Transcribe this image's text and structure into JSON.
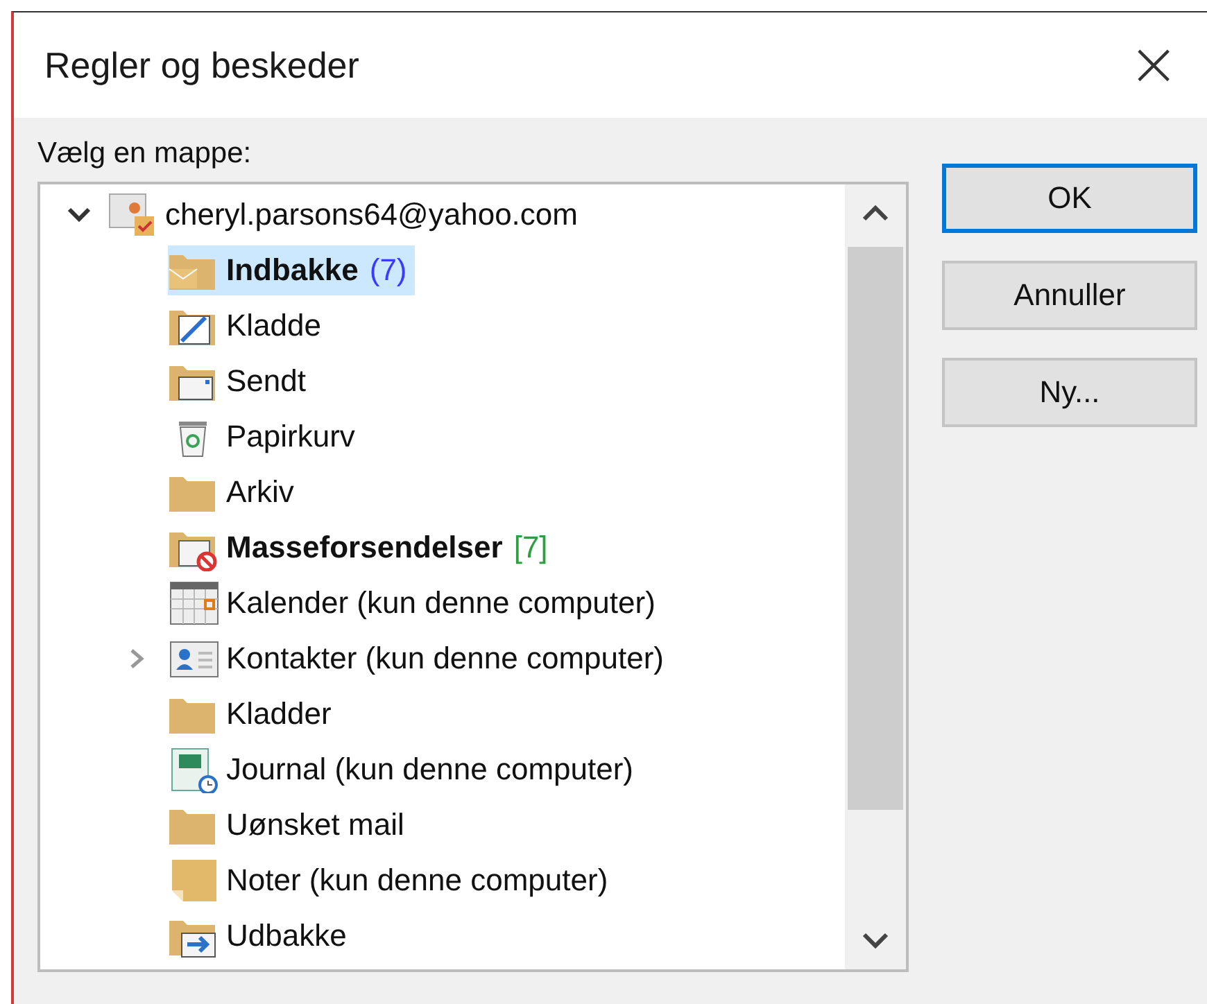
{
  "window": {
    "title": "Regler og beskeder",
    "close": "×"
  },
  "prompt": "Vælg en mappe:",
  "tree": {
    "root": {
      "label": "cheryl.parsons64@yahoo.com",
      "kind": "account",
      "expanded": true,
      "children": [
        {
          "label": "Indbakke",
          "kind": "inbox",
          "bold": true,
          "selected": true,
          "count": "(7)",
          "color": "#3b3bff"
        },
        {
          "label": "Kladde",
          "kind": "drafts",
          "bold": false,
          "selected": false
        },
        {
          "label": "Sendt",
          "kind": "sent",
          "bold": false,
          "selected": false
        },
        {
          "label": "Papirkurv",
          "kind": "trash",
          "bold": false,
          "selected": false
        },
        {
          "label": "Arkiv",
          "kind": "folder",
          "bold": false,
          "selected": false
        },
        {
          "label": "Masseforsendelser",
          "kind": "junk",
          "bold": true,
          "selected": false,
          "count": "[7]",
          "color": "#2e9e3e"
        },
        {
          "label": "Kalender (kun denne computer)",
          "kind": "calendar",
          "bold": false,
          "selected": false
        },
        {
          "label": "Kontakter (kun denne computer)",
          "kind": "contacts",
          "bold": false,
          "selected": false,
          "expanded": false
        },
        {
          "label": "Kladder",
          "kind": "folder",
          "bold": false,
          "selected": false
        },
        {
          "label": "Journal (kun denne computer)",
          "kind": "journal",
          "bold": false,
          "selected": false
        },
        {
          "label": "Uønsket mail",
          "kind": "folder",
          "bold": false,
          "selected": false
        },
        {
          "label": "Noter (kun denne computer)",
          "kind": "notes",
          "bold": false,
          "selected": false
        },
        {
          "label": "Udbakke",
          "kind": "outbox",
          "bold": false,
          "selected": false
        }
      ]
    }
  },
  "buttons": [
    {
      "label": "OK",
      "default": true
    },
    {
      "label": "Annuller",
      "default": false
    },
    {
      "label": "Ny...",
      "default": false
    }
  ]
}
